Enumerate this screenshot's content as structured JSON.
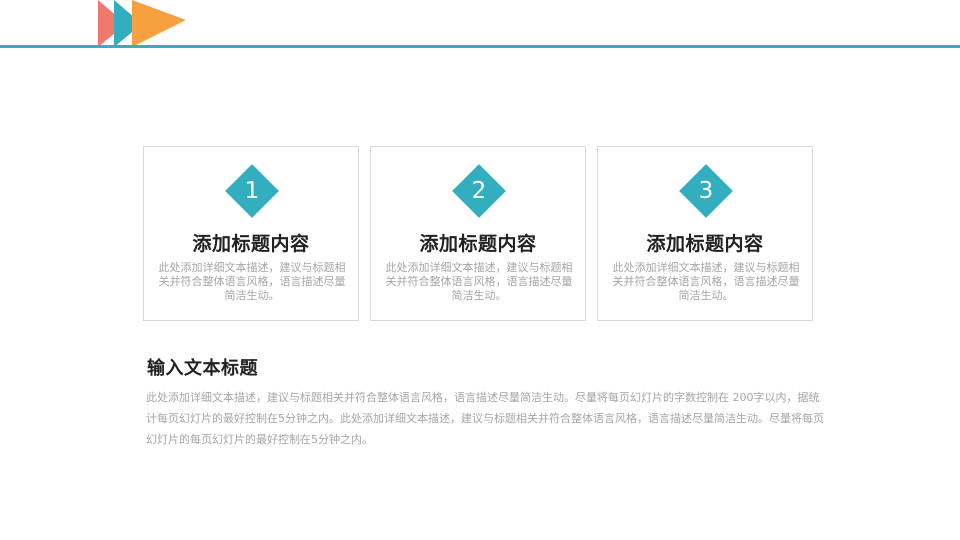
{
  "colors": {
    "accent": "#33aebf",
    "coral": "#f0786c",
    "orange": "#f7a03f",
    "title_text": "#222222",
    "body_text": "#a6a6a6",
    "card_border": "#d9d9d9"
  },
  "header": {
    "logo_icon": "triangles-logo-icon"
  },
  "cards": [
    {
      "number": "1",
      "title": "添加标题内容",
      "description": "此处添加详细文本描述，建议与标题相关并符合整体语言风格，语言描述尽量简洁生动。"
    },
    {
      "number": "2",
      "title": "添加标题内容",
      "description": "此处添加详细文本描述，建议与标题相关并符合整体语言风格，语言描述尽量简洁生动。"
    },
    {
      "number": "3",
      "title": "添加标题内容",
      "description": "此处添加详细文本描述，建议与标题相关并符合整体语言风格，语言描述尽量简洁生动。"
    }
  ],
  "section": {
    "title": "输入文本标题",
    "body": "此处添加详细文本描述，建议与标题相关并符合整体语言风格，语言描述尽量简洁生动。尽量将每页幻灯片的字数控制在 200字以内，据统计每页幻灯片的最好控制在5分钟之内。此处添加详细文本描述，建议与标题相关并符合整体语言风格，语言描述尽量简洁生动。尽量将每页幻灯片的每页幻灯片的最好控制在5分钟之内。"
  }
}
